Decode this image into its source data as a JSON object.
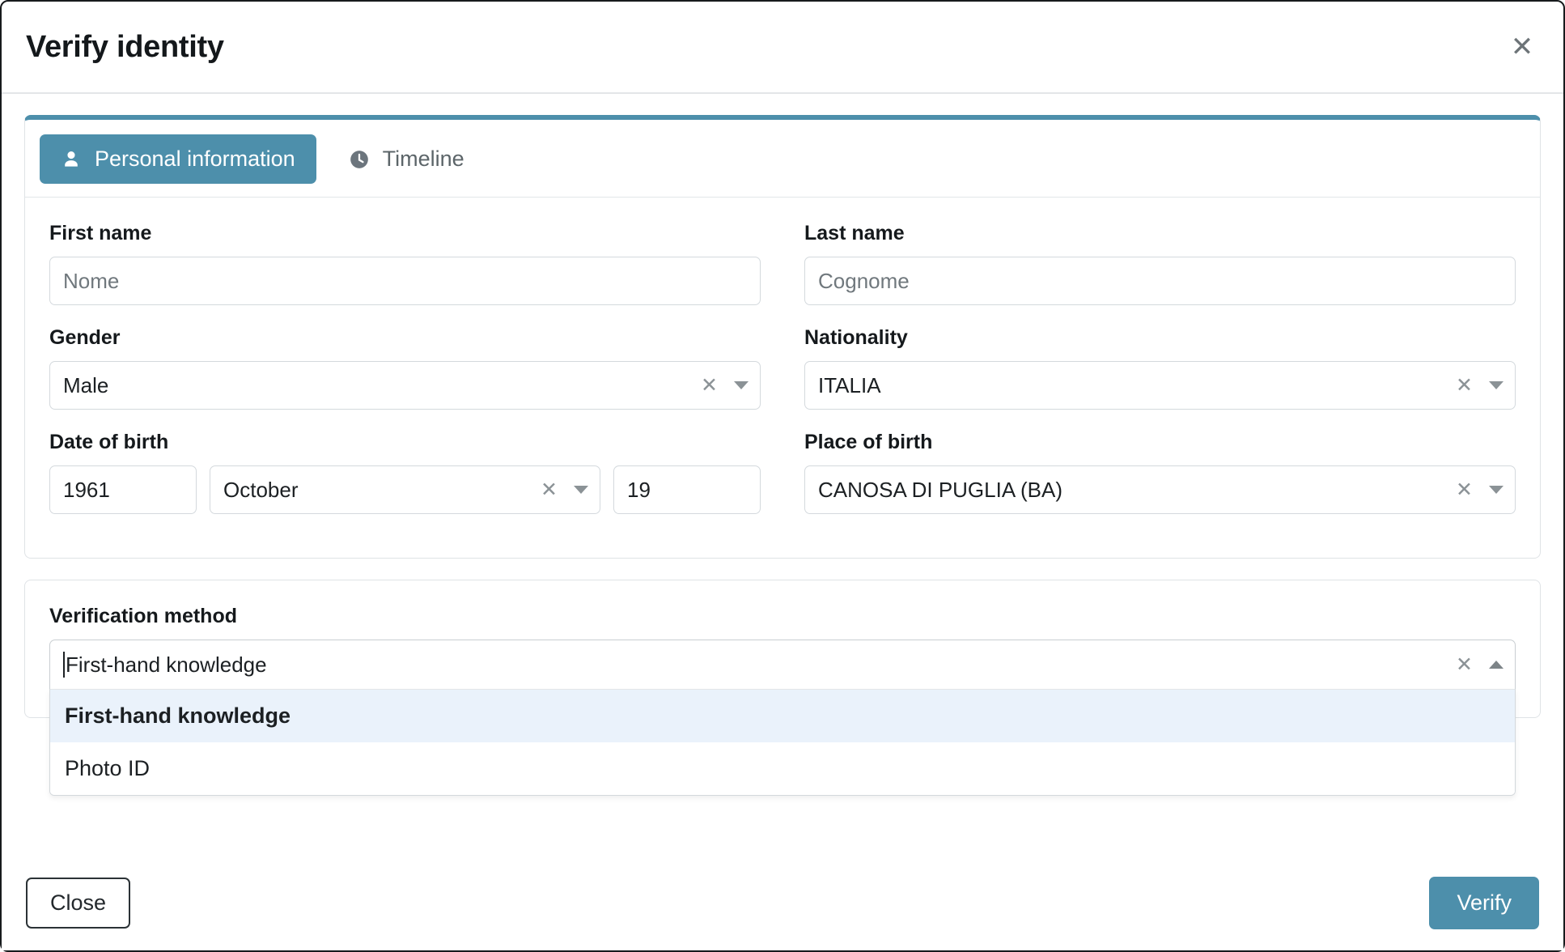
{
  "modal": {
    "title": "Verify identity",
    "close_icon": "close-icon"
  },
  "tabs": [
    {
      "label": "Personal information",
      "icon": "user-icon",
      "active": true
    },
    {
      "label": "Timeline",
      "icon": "clock-icon",
      "active": false
    }
  ],
  "personal_information": {
    "first_name": {
      "label": "First name",
      "value": "",
      "placeholder": "Nome"
    },
    "last_name": {
      "label": "Last name",
      "value": "",
      "placeholder": "Cognome"
    },
    "gender": {
      "label": "Gender",
      "value": "Male",
      "clear_icon": "clear-icon",
      "caret_icon": "chevron-down-icon"
    },
    "nationality": {
      "label": "Nationality",
      "value": "ITALIA",
      "clear_icon": "clear-icon",
      "caret_icon": "chevron-down-icon"
    },
    "date_of_birth": {
      "label": "Date of birth",
      "year": "1961",
      "month": "October",
      "day": "19",
      "clear_icon": "clear-icon",
      "caret_icon": "chevron-down-icon"
    },
    "place_of_birth": {
      "label": "Place of birth",
      "value": "CANOSA DI PUGLIA (BA)",
      "clear_icon": "clear-icon",
      "caret_icon": "chevron-down-icon"
    }
  },
  "verification": {
    "label": "Verification method",
    "value": "First-hand knowledge",
    "expanded": true,
    "clear_icon": "clear-icon",
    "caret_icon": "chevron-up-icon",
    "options": [
      {
        "label": "First-hand knowledge",
        "highlighted": true
      },
      {
        "label": "Photo ID",
        "highlighted": false
      }
    ]
  },
  "footer": {
    "close_label": "Close",
    "verify_label": "Verify"
  },
  "colors": {
    "accent": "#4d8fab",
    "option_highlight": "#eaf2fb",
    "border": "#dfe3e6",
    "text": "#15191c"
  }
}
